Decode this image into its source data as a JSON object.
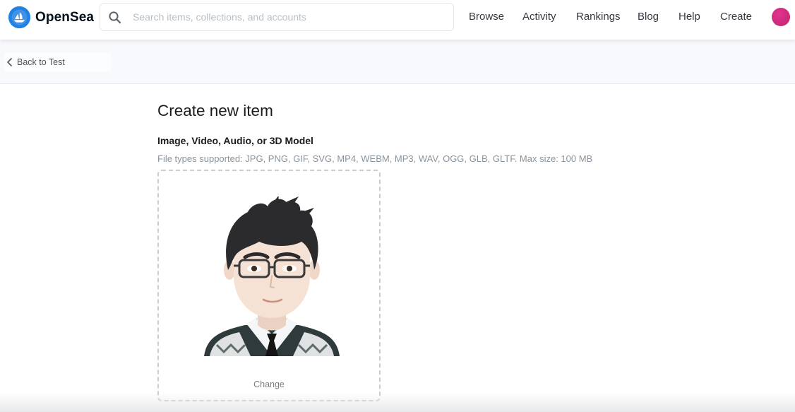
{
  "header": {
    "brand": "OpenSea",
    "search": {
      "placeholder": "Search items, collections, and accounts",
      "value": ""
    },
    "nav": [
      "Browse",
      "Activity",
      "Rankings",
      "Blog",
      "Help",
      "Create"
    ],
    "avatar_color": "#cf2c7f",
    "brand_color": "#2081e2"
  },
  "subheader": {
    "back_label": "Back to Test"
  },
  "main": {
    "title": "Create new item",
    "media_field": {
      "label": "Image, Video, Audio, or 3D Model",
      "help": "File types supported: JPG, PNG, GIF, SVG, MP4, WEBM, MP3, WAV, OGG, GLB, GLTF. Max size: 100 MB",
      "change_label": "Change",
      "preview_icon": "cartoon-avatar-preview"
    }
  }
}
